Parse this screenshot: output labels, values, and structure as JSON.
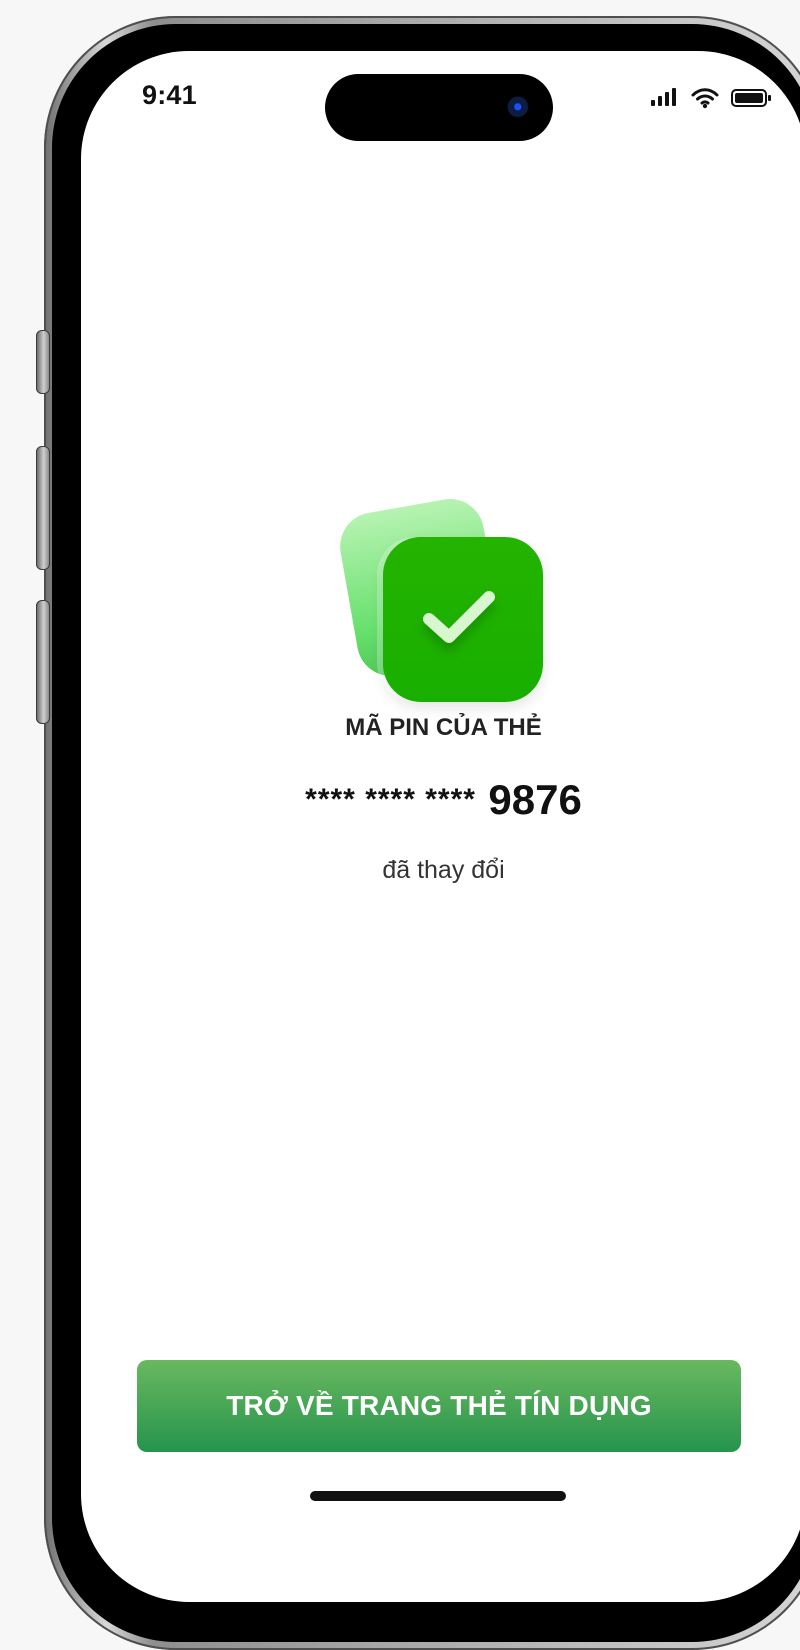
{
  "status_bar": {
    "time": "9:41"
  },
  "success": {
    "title": "MÃ PIN CỦA THẺ",
    "masked_card": "**** **** ****",
    "last4": "9876",
    "status": "đã thay đổi"
  },
  "actions": {
    "primary_label": "TRỞ VỀ TRANG THẺ TÍN DỤNG"
  },
  "colors": {
    "accent_green": "#1fb000",
    "button_top": "#6ab85f",
    "button_bottom": "#25944d"
  }
}
